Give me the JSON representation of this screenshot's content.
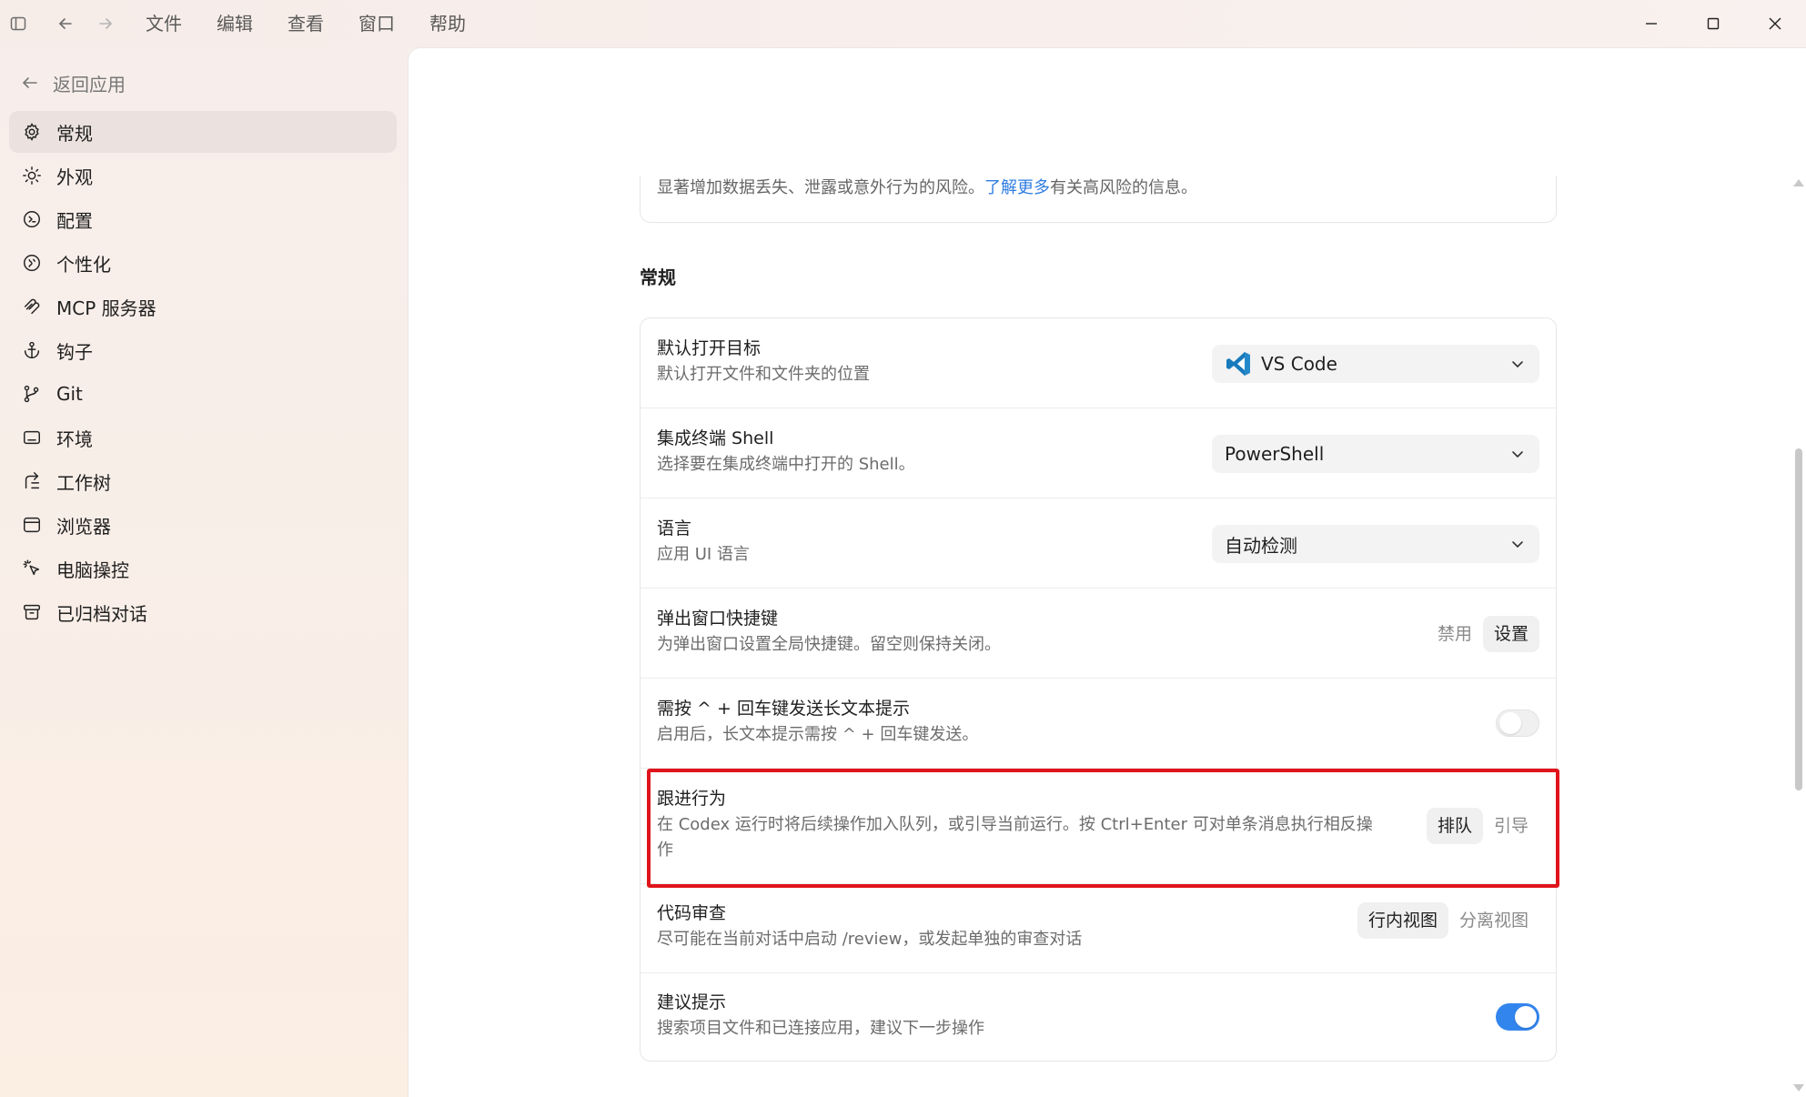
{
  "titlebar": {
    "menu": [
      "文件",
      "编辑",
      "查看",
      "窗口",
      "帮助"
    ]
  },
  "sidebar": {
    "back_label": "返回应用",
    "items": [
      {
        "label": "常规",
        "icon": "gear-icon"
      },
      {
        "label": "外观",
        "icon": "sun-icon"
      },
      {
        "label": "配置",
        "icon": "config-icon"
      },
      {
        "label": "个性化",
        "icon": "personalize-icon"
      },
      {
        "label": "MCP 服务器",
        "icon": "mcp-icon"
      },
      {
        "label": "钩子",
        "icon": "anchor-icon"
      },
      {
        "label": "Git",
        "icon": "git-branch-icon"
      },
      {
        "label": "环境",
        "icon": "environment-icon"
      },
      {
        "label": "工作树",
        "icon": "worktree-icon"
      },
      {
        "label": "浏览器",
        "icon": "browser-icon"
      },
      {
        "label": "电脑操控",
        "icon": "pointer-click-icon"
      },
      {
        "label": "已归档对话",
        "icon": "archive-icon"
      }
    ],
    "active_index": 0
  },
  "main": {
    "top_card": {
      "text_before": "显著增加数据丢失、泄露或意外行为的风险。",
      "link": "了解更多",
      "text_after": "有关高风险的信息。"
    },
    "section_title": "常规",
    "rows": {
      "open_target": {
        "label": "默认打开目标",
        "desc": "默认打开文件和文件夹的位置",
        "value": "VS Code"
      },
      "shell": {
        "label": "集成终端 Shell",
        "desc": "选择要在集成终端中打开的 Shell。",
        "value": "PowerShell"
      },
      "language": {
        "label": "语言",
        "desc": "应用 UI 语言",
        "value": "自动检测"
      },
      "hotkey": {
        "label": "弹出窗口快捷键",
        "desc": "为弹出窗口设置全局快捷键。留空则保持关闭。",
        "disable": "禁用",
        "set": "设置"
      },
      "long_prompt": {
        "label": "需按 ^ + 回车键发送长文本提示",
        "desc": "启用后，长文本提示需按 ^ + 回车键发送。",
        "enabled": false
      },
      "follow_up": {
        "label": "跟进行为",
        "desc": "在 Codex 运行时将后续操作加入队列，或引导当前运行。按 Ctrl+Enter 可对单条消息执行相反操作",
        "options": [
          "排队",
          "引导"
        ],
        "selected": "排队"
      },
      "code_review": {
        "label": "代码审查",
        "desc": "尽可能在当前对话中启动 /review，或发起单独的审查对话",
        "options": [
          "行内视图",
          "分离视图"
        ],
        "selected": "行内视图"
      },
      "suggestions": {
        "label": "建议提示",
        "desc": "搜索项目文件和已连接应用，建议下一步操作",
        "enabled": true
      }
    }
  },
  "colors": {
    "accent": "#3385ee",
    "link": "#2f7de1",
    "highlight_border": "#e0141b"
  }
}
